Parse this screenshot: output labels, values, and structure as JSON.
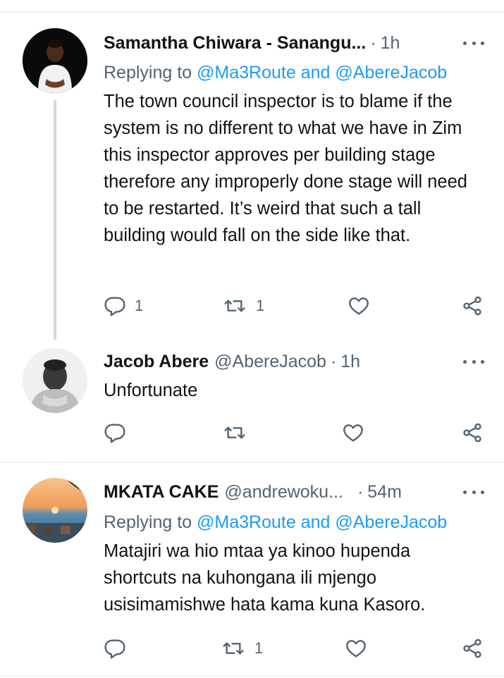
{
  "tweets": [
    {
      "name": "Samantha Chiwara - Sanangu...",
      "handle": "",
      "time": "1h",
      "replying_prefix": "Replying to ",
      "replying_to": "@Ma3Route and @AbereJacob",
      "body": "The town council inspector is to blame if the system is no different to what we have in Zim this inspector approves per building stage therefore any improperly done stage will need to be restarted. It’s weird that such a tall building would fall on the side like that.",
      "reply_count": "1",
      "retweet_count": "1",
      "like_count": ""
    },
    {
      "name": "Jacob Abere",
      "handle": "@AbereJacob",
      "time": "1h",
      "body": "Unfortunate",
      "reply_count": "",
      "retweet_count": "",
      "like_count": ""
    },
    {
      "name": "MKATA CAKE",
      "handle": "@andrewoku...",
      "time": "54m",
      "replying_prefix": "Replying to ",
      "replying_to": "@Ma3Route and @AbereJacob",
      "body": "Matajiri wa hio mtaa ya kinoo hupenda shortcuts na kuhongana ili mjengo usisimamishwe hata kama kuna Kasoro.",
      "reply_count": "",
      "retweet_count": "1",
      "like_count": ""
    }
  ],
  "meta": {
    "separator": "·"
  },
  "colors": {
    "text": "#0f1419",
    "secondary": "#536471",
    "link": "#1d9bf0",
    "divider": "#eff3f4",
    "thread_line": "#cfd9de"
  },
  "icons": [
    "more-icon",
    "reply-icon",
    "retweet-icon",
    "like-icon",
    "share-icon"
  ]
}
